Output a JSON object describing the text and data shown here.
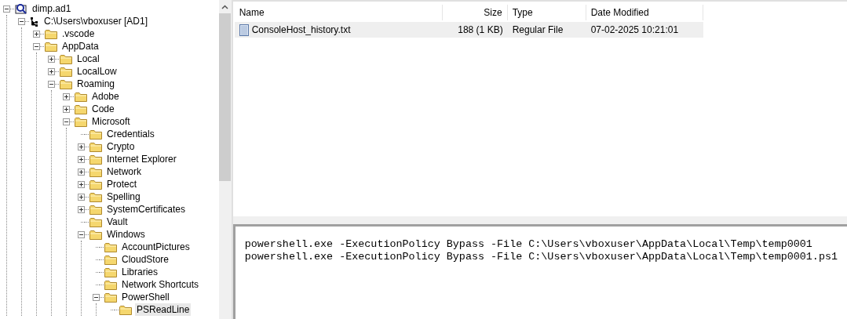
{
  "tree": [
    {
      "label": "dimp.ad1",
      "kind": "expanded",
      "selected": false,
      "children": [
        {
          "label": "C:\\Users\\vboxuser [AD1]",
          "kind": "expanded",
          "selected": false,
          "children": [
            {
              "label": ".vscode",
              "kind": "collapsed",
              "selected": false
            },
            {
              "label": "AppData",
              "kind": "expanded",
              "selected": false,
              "children": [
                {
                  "label": "Local",
                  "kind": "collapsed",
                  "selected": false
                },
                {
                  "label": "LocalLow",
                  "kind": "collapsed",
                  "selected": false
                },
                {
                  "label": "Roaming",
                  "kind": "expanded",
                  "selected": false,
                  "children": [
                    {
                      "label": "Adobe",
                      "kind": "collapsed",
                      "selected": false
                    },
                    {
                      "label": "Code",
                      "kind": "collapsed",
                      "selected": false
                    },
                    {
                      "label": "Microsoft",
                      "kind": "expanded",
                      "selected": false,
                      "children": [
                        {
                          "label": "Credentials",
                          "kind": "leaf",
                          "selected": false
                        },
                        {
                          "label": "Crypto",
                          "kind": "collapsed",
                          "selected": false
                        },
                        {
                          "label": "Internet Explorer",
                          "kind": "collapsed",
                          "selected": false
                        },
                        {
                          "label": "Network",
                          "kind": "collapsed",
                          "selected": false
                        },
                        {
                          "label": "Protect",
                          "kind": "collapsed",
                          "selected": false
                        },
                        {
                          "label": "Spelling",
                          "kind": "collapsed",
                          "selected": false
                        },
                        {
                          "label": "SystemCertificates",
                          "kind": "collapsed",
                          "selected": false
                        },
                        {
                          "label": "Vault",
                          "kind": "leaf",
                          "selected": false
                        },
                        {
                          "label": "Windows",
                          "kind": "expanded",
                          "selected": false,
                          "children": [
                            {
                              "label": "AccountPictures",
                              "kind": "leaf",
                              "selected": false
                            },
                            {
                              "label": "CloudStore",
                              "kind": "leaf",
                              "selected": false
                            },
                            {
                              "label": "Libraries",
                              "kind": "leaf",
                              "selected": false
                            },
                            {
                              "label": "Network Shortcuts",
                              "kind": "leaf",
                              "selected": false
                            },
                            {
                              "label": "PowerShell",
                              "kind": "expanded",
                              "selected": false,
                              "children": [
                                {
                                  "label": "PSReadLine",
                                  "kind": "leaf",
                                  "selected": true
                                }
                              ]
                            }
                          ]
                        }
                      ]
                    }
                  ]
                }
              ]
            }
          ]
        }
      ]
    }
  ],
  "file_list": {
    "columns": [
      {
        "label": "Name"
      },
      {
        "label": "Size"
      },
      {
        "label": "Type"
      },
      {
        "label": "Date Modified"
      }
    ],
    "rows": [
      {
        "cells": [
          "ConsoleHost_history.txt",
          "188 (1 KB)",
          "Regular File",
          "07-02-2025 10:21:01"
        ],
        "selected": true
      }
    ]
  },
  "text_view": {
    "lines": [
      "powershell.exe -ExecutionPolicy Bypass -File C:\\Users\\vboxuser\\AppData\\Local\\Temp\\temp0001",
      "powershell.exe -ExecutionPolicy Bypass -File C:\\Users\\vboxuser\\AppData\\Local\\Temp\\temp0001.ps1"
    ]
  }
}
